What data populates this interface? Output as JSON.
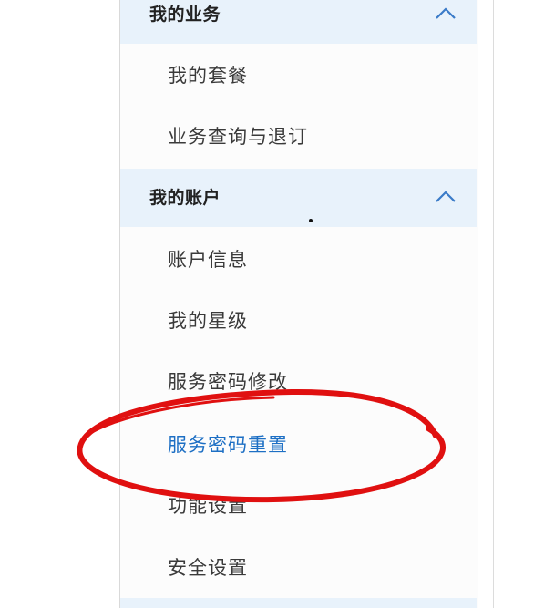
{
  "menu": {
    "groups": [
      {
        "title": "我的业务",
        "expanded": true,
        "chevron_icon": "chevron-up-icon",
        "items": [
          {
            "label": "我的套餐",
            "active": false
          },
          {
            "label": "业务查询与退订",
            "active": false
          }
        ]
      },
      {
        "title": "我的账户",
        "expanded": true,
        "chevron_icon": "chevron-up-icon",
        "items": [
          {
            "label": "账户信息",
            "active": false
          },
          {
            "label": "我的星级",
            "active": false
          },
          {
            "label": "服务密码修改",
            "active": false
          },
          {
            "label": "服务密码重置",
            "active": true
          },
          {
            "label": "功能设置",
            "active": false
          },
          {
            "label": "安全设置",
            "active": false
          }
        ]
      }
    ]
  },
  "colors": {
    "header_bg": "#e8f2fb",
    "active_text": "#1d6fc4",
    "annotation_red": "#e01010"
  }
}
